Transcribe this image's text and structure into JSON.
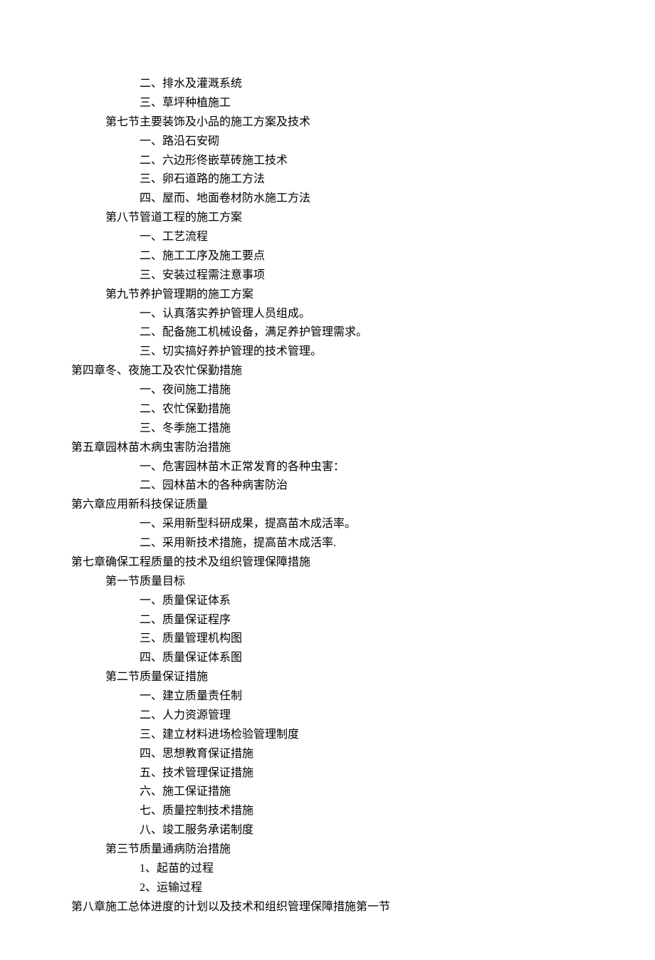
{
  "lines": [
    {
      "indent": 2,
      "text": "二、排水及灌溉系统"
    },
    {
      "indent": 2,
      "text": "三、草坪种植施工"
    },
    {
      "indent": 1,
      "text": "第七节主要装饰及小品的施工方案及技术"
    },
    {
      "indent": 2,
      "text": "一、路沿石安砌"
    },
    {
      "indent": 2,
      "text": "二、六边形佟嵌草砖施工技术"
    },
    {
      "indent": 2,
      "text": "三、卵石道路的施工方法"
    },
    {
      "indent": 2,
      "text": "四、屋而、地面卷材防水施工方法"
    },
    {
      "indent": 1,
      "text": "第八节管道工程的施工方案"
    },
    {
      "indent": 2,
      "text": "一、工艺流程"
    },
    {
      "indent": 2,
      "text": "二、施工工序及施工要点"
    },
    {
      "indent": 2,
      "text": "三、安装过程需注意事项"
    },
    {
      "indent": 1,
      "text": "第九节养护管理期的施工方案"
    },
    {
      "indent": 2,
      "text": "一、认真落实养护管理人员组成。"
    },
    {
      "indent": 2,
      "text": "二、配备施工机械设备，满足养护管理需求。"
    },
    {
      "indent": 2,
      "text": "三、切实搞好养护管理的技术管理。"
    },
    {
      "indent": 0,
      "text": "第四章冬、夜施工及农忙保勤措施"
    },
    {
      "indent": 2,
      "text": "一、夜间施工措施"
    },
    {
      "indent": 2,
      "text": "二、农忙保勤措施"
    },
    {
      "indent": 2,
      "text": "三、冬季施工措施"
    },
    {
      "indent": 0,
      "text": "第五章园林苗木病虫害防治措施"
    },
    {
      "indent": 2,
      "text": "一、危害园林苗木正常发育的各种虫害："
    },
    {
      "indent": 2,
      "text": "二、园林苗木的各种病害防治"
    },
    {
      "indent": 0,
      "text": "第六章应用新科技保证质量"
    },
    {
      "indent": 2,
      "text": "一、采用新型科研成果，提高苗木成活率。"
    },
    {
      "indent": 2,
      "text": "二、采用新技术措施，提高苗木成活率."
    },
    {
      "indent": 0,
      "text": "第七章确保工程质量的技术及组织管理保障措施"
    },
    {
      "indent": 1,
      "text": "第一节质量目标"
    },
    {
      "indent": 2,
      "text": "一、质量保证体系"
    },
    {
      "indent": 2,
      "text": "二、质量保证程序"
    },
    {
      "indent": 2,
      "text": "三、质量管理机构图"
    },
    {
      "indent": 2,
      "text": "四、质量保证体系图"
    },
    {
      "indent": 1,
      "text": "第二节质量保证措施"
    },
    {
      "indent": 2,
      "text": "一、建立质量责任制"
    },
    {
      "indent": 2,
      "text": "二、人力资源管理"
    },
    {
      "indent": 2,
      "text": "三、建立材料进场检验管理制度"
    },
    {
      "indent": 2,
      "text": "四、思想教育保证措施"
    },
    {
      "indent": 2,
      "text": "五、技术管理保证措施"
    },
    {
      "indent": 2,
      "text": "六、施工保证措施"
    },
    {
      "indent": 2,
      "text": "七、质量控制技术措施"
    },
    {
      "indent": 2,
      "text": "八、竣工服务承诺制度"
    },
    {
      "indent": 1,
      "text": "第三节质量通病防治措施"
    },
    {
      "indent": 2,
      "text": "1、起苗的过程"
    },
    {
      "indent": 2,
      "text": "2、运输过程"
    },
    {
      "indent": 0,
      "text": "第八章施工总体进度的计划以及技术和组织管理保障措施第一节"
    }
  ]
}
